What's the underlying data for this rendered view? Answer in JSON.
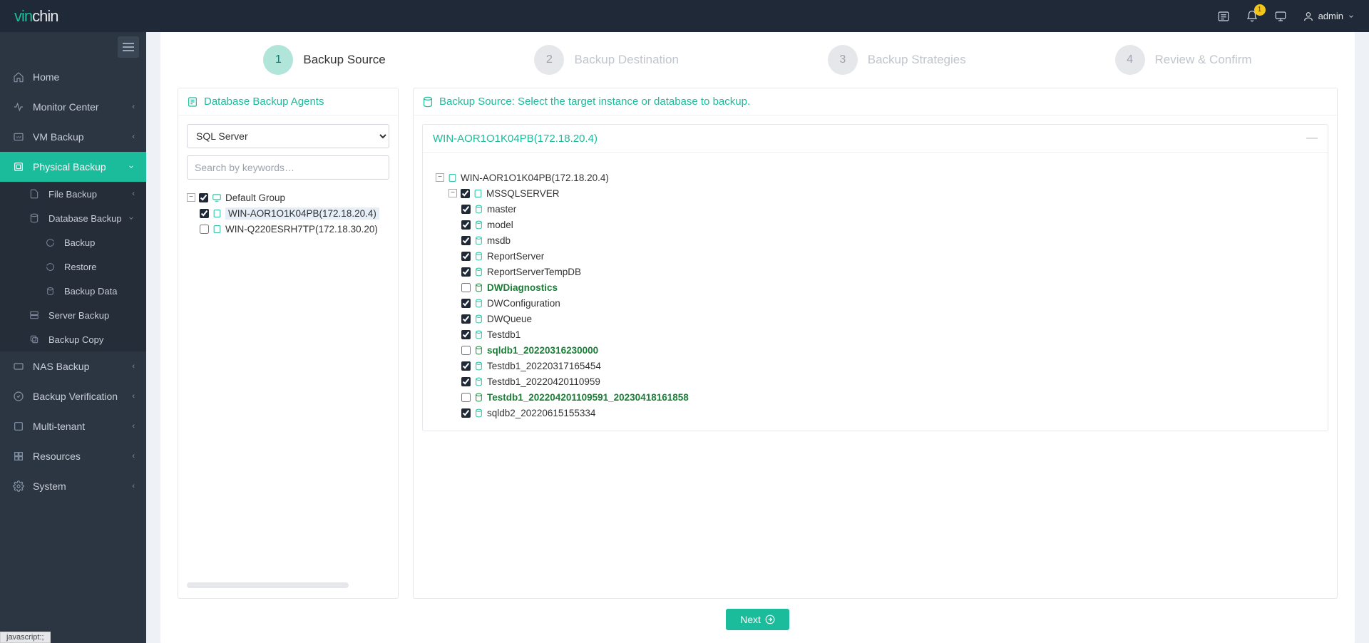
{
  "header": {
    "brand_prefix": "vin",
    "brand_rest": "chin",
    "notification_count": "1",
    "user_label": "admin"
  },
  "sidebar": {
    "items": [
      {
        "label": "Home"
      },
      {
        "label": "Monitor Center"
      },
      {
        "label": "VM Backup"
      },
      {
        "label": "Physical Backup"
      },
      {
        "label": "NAS Backup"
      },
      {
        "label": "Backup Verification"
      },
      {
        "label": "Multi-tenant"
      },
      {
        "label": "Resources"
      },
      {
        "label": "System"
      }
    ],
    "physical_sub": [
      {
        "label": "File Backup"
      },
      {
        "label": "Database Backup"
      },
      {
        "label": "Server Backup"
      },
      {
        "label": "Backup Copy"
      }
    ],
    "db_sub": [
      {
        "label": "Backup"
      },
      {
        "label": "Restore"
      },
      {
        "label": "Backup Data"
      }
    ]
  },
  "wizard": {
    "steps": [
      {
        "num": "1",
        "label": "Backup Source"
      },
      {
        "num": "2",
        "label": "Backup Destination"
      },
      {
        "num": "3",
        "label": "Backup Strategies"
      },
      {
        "num": "4",
        "label": "Review & Confirm"
      }
    ],
    "next_label": "Next"
  },
  "left_panel": {
    "title": "Database Backup Agents",
    "select_value": "SQL Server",
    "search_placeholder": "Search by keywords…",
    "group_label": "Default Group",
    "hosts": [
      {
        "label": "WIN-AOR1O1K04PB(172.18.20.4)",
        "checked": true,
        "selected": true
      },
      {
        "label": "WIN-Q220ESRH7TP(172.18.30.20)",
        "checked": false,
        "selected": false
      }
    ]
  },
  "right_panel": {
    "title": "Backup Source: Select the target instance or database to backup.",
    "sub_header": "WIN-AOR1O1K04PB(172.18.20.4)",
    "root_host": "WIN-AOR1O1K04PB(172.18.20.4)",
    "instance": "MSSQLSERVER",
    "databases": [
      {
        "name": "master",
        "checked": true,
        "highlight": false
      },
      {
        "name": "model",
        "checked": true,
        "highlight": false
      },
      {
        "name": "msdb",
        "checked": true,
        "highlight": false
      },
      {
        "name": "ReportServer",
        "checked": true,
        "highlight": false
      },
      {
        "name": "ReportServerTempDB",
        "checked": true,
        "highlight": false
      },
      {
        "name": "DWDiagnostics",
        "checked": false,
        "highlight": true
      },
      {
        "name": "DWConfiguration",
        "checked": true,
        "highlight": false
      },
      {
        "name": "DWQueue",
        "checked": true,
        "highlight": false
      },
      {
        "name": "Testdb1",
        "checked": true,
        "highlight": false
      },
      {
        "name": "sqldb1_20220316230000",
        "checked": false,
        "highlight": true
      },
      {
        "name": "Testdb1_20220317165454",
        "checked": true,
        "highlight": false
      },
      {
        "name": "Testdb1_20220420110959",
        "checked": true,
        "highlight": false
      },
      {
        "name": "Testdb1_202204201109591_20230418161858",
        "checked": false,
        "highlight": true
      },
      {
        "name": "sqldb2_20220615155334",
        "checked": true,
        "highlight": false
      }
    ]
  },
  "status_bar": "javascript:;"
}
